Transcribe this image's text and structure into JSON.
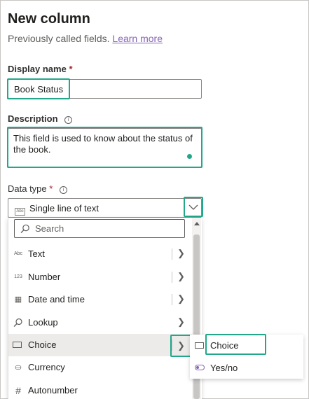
{
  "header": {
    "title": "New column",
    "subtitle": "Previously called fields.",
    "learn_more": "Learn more"
  },
  "display_name": {
    "label": "Display name",
    "required_mark": "*",
    "value": "Book Status"
  },
  "description": {
    "label": "Description",
    "info_icon": "info-icon",
    "value": "This field is used to know about the status of the book."
  },
  "data_type": {
    "label": "Data type",
    "required_mark": "*",
    "info_icon": "info-icon",
    "selected": "Single line of text",
    "selected_icon_text": "Abc",
    "search_placeholder": "Search"
  },
  "menu_items": [
    {
      "label": "Text",
      "icon": "text-icon",
      "icon_text": "Abc"
    },
    {
      "label": "Number",
      "icon": "number-icon",
      "icon_text": "123"
    },
    {
      "label": "Date and time",
      "icon": "calendar-icon",
      "icon_text": "▦"
    },
    {
      "label": "Lookup",
      "icon": "search-icon",
      "icon_text": "⚲"
    },
    {
      "label": "Choice",
      "icon": "choice-icon",
      "icon_text": "▭"
    },
    {
      "label": "Currency",
      "icon": "currency-icon",
      "icon_text": "⛀"
    },
    {
      "label": "Autonumber",
      "icon": "hash-icon",
      "icon_text": "#"
    }
  ],
  "submenu_items": [
    {
      "label": "Choice",
      "icon": "choice-icon"
    },
    {
      "label": "Yes/no",
      "icon": "toggle-icon"
    }
  ],
  "colors": {
    "highlight": "#22a78a",
    "link": "#8764b8",
    "required": "#a4262c"
  }
}
